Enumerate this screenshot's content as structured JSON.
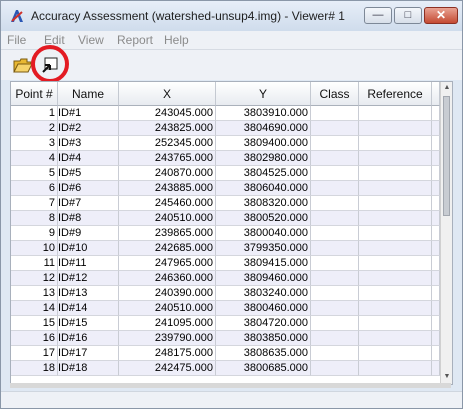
{
  "window": {
    "title": "Accuracy Assessment (watershed-unsup4.img) - Viewer# 1"
  },
  "controls": {
    "minimize": "—",
    "maximize": "□",
    "close": "✕"
  },
  "menu": [
    "File",
    "Edit",
    "View",
    "Report",
    "Help"
  ],
  "toolbar": {
    "icons": [
      "open-folder-icon",
      "select-viewer-icon"
    ]
  },
  "columns": [
    "Point #",
    "Name",
    "X",
    "Y",
    "Class",
    "Reference"
  ],
  "rows": [
    {
      "num": "1",
      "name": "ID#1",
      "x": "243045.000",
      "y": "3803910.000"
    },
    {
      "num": "2",
      "name": "ID#2",
      "x": "243825.000",
      "y": "3804690.000"
    },
    {
      "num": "3",
      "name": "ID#3",
      "x": "252345.000",
      "y": "3809400.000"
    },
    {
      "num": "4",
      "name": "ID#4",
      "x": "243765.000",
      "y": "3802980.000"
    },
    {
      "num": "5",
      "name": "ID#5",
      "x": "240870.000",
      "y": "3804525.000"
    },
    {
      "num": "6",
      "name": "ID#6",
      "x": "243885.000",
      "y": "3806040.000"
    },
    {
      "num": "7",
      "name": "ID#7",
      "x": "245460.000",
      "y": "3808320.000"
    },
    {
      "num": "8",
      "name": "ID#8",
      "x": "240510.000",
      "y": "3800520.000"
    },
    {
      "num": "9",
      "name": "ID#9",
      "x": "239865.000",
      "y": "3800040.000"
    },
    {
      "num": "10",
      "name": "ID#10",
      "x": "242685.000",
      "y": "3799350.000"
    },
    {
      "num": "11",
      "name": "ID#11",
      "x": "247965.000",
      "y": "3809415.000"
    },
    {
      "num": "12",
      "name": "ID#12",
      "x": "246360.000",
      "y": "3809460.000"
    },
    {
      "num": "13",
      "name": "ID#13",
      "x": "240390.000",
      "y": "3803240.000"
    },
    {
      "num": "14",
      "name": "ID#14",
      "x": "240510.000",
      "y": "3800460.000"
    },
    {
      "num": "15",
      "name": "ID#15",
      "x": "241095.000",
      "y": "3804720.000"
    },
    {
      "num": "16",
      "name": "ID#16",
      "x": "239790.000",
      "y": "3803850.000"
    },
    {
      "num": "17",
      "name": "ID#17",
      "x": "248175.000",
      "y": "3808635.000"
    },
    {
      "num": "18",
      "name": "ID#18",
      "x": "242475.000",
      "y": "3800685.000"
    }
  ]
}
